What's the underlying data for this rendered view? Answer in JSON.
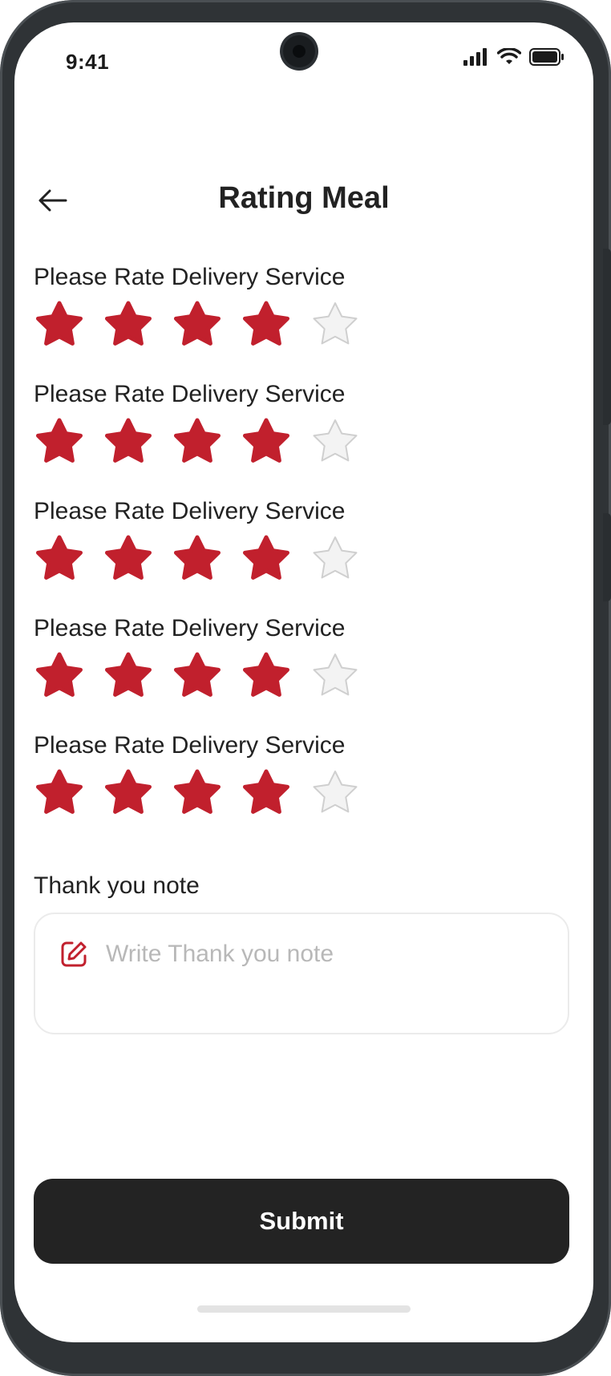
{
  "status": {
    "time": "9:41"
  },
  "header": {
    "title": "Rating Meal"
  },
  "ratings": [
    {
      "label": "Please Rate Delivery Service",
      "value": 4,
      "max": 5
    },
    {
      "label": "Please Rate Delivery Service",
      "value": 4,
      "max": 5
    },
    {
      "label": "Please Rate Delivery Service",
      "value": 4,
      "max": 5
    },
    {
      "label": "Please Rate Delivery Service",
      "value": 4,
      "max": 5
    },
    {
      "label": "Please Rate Delivery Service",
      "value": 4,
      "max": 5
    }
  ],
  "note": {
    "label": "Thank you note",
    "placeholder": "Write Thank you note",
    "value": ""
  },
  "submit": {
    "label": "Submit"
  },
  "colors": {
    "star_filled": "#C1202D",
    "star_empty": "#F3F3F3",
    "star_empty_stroke": "#CFCFCF",
    "button_bg": "#232323",
    "accent": "#C1202D"
  },
  "icons": {
    "back": "arrow-left-icon",
    "edit": "edit-note-icon",
    "signal": "signal-icon",
    "wifi": "wifi-icon",
    "battery": "battery-icon"
  }
}
